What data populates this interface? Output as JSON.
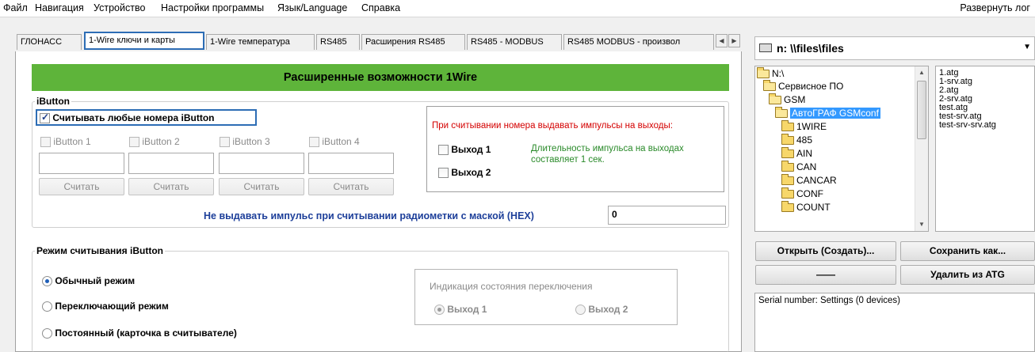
{
  "menubar": {
    "items": [
      "Файл",
      "Навигация",
      "Устройство",
      "Настройки программы",
      "Язык/Language",
      "Справка"
    ],
    "expand_label": "Развернуть лог"
  },
  "tabs": {
    "items": [
      "ГЛОНАСС",
      "1-Wire ключи и карты",
      "1-Wire температура",
      "RS485",
      "Расширения RS485",
      "RS485 - MODBUS",
      "RS485 MODBUS - произвол"
    ],
    "active_index": 1
  },
  "banner": {
    "title": "Расширенные возможности 1Wire"
  },
  "ibutton": {
    "group_title": "iButton",
    "read_any_label": "Считывать любые номера iButton",
    "read_any_checked": true,
    "slots": [
      {
        "label": "iButton 1",
        "value": "",
        "button": "Считать"
      },
      {
        "label": "iButton 2",
        "value": "",
        "button": "Считать"
      },
      {
        "label": "iButton 3",
        "value": "",
        "button": "Считать"
      },
      {
        "label": "iButton 4",
        "value": "",
        "button": "Считать"
      }
    ],
    "pulse_title": "При считывании номера выдавать импульсы на выходы:",
    "output1_label": "Выход 1",
    "output2_label": "Выход 2",
    "pulse_note": "Длительность импульса на выходах составляет 1 сек.",
    "mask_label": "Не выдавать импульс при считывании радиометки с маской (HEX)",
    "mask_value": "0"
  },
  "read_mode": {
    "group_title": "Режим считывания iButton",
    "options": [
      "Обычный режим",
      "Переключающий режим",
      "Постоянный (карточка в считывателе)"
    ],
    "selected_index": 0,
    "indication_title": "Индикация состояния переключения",
    "indication_options": [
      "Выход 1",
      "Выход 2"
    ],
    "indication_selected": 0
  },
  "file_browser": {
    "drive_label": "n: \\\\files\\files",
    "tree": [
      {
        "name": "N:\\",
        "level": 0,
        "open": true
      },
      {
        "name": "Сервисное ПО",
        "level": 1,
        "open": true
      },
      {
        "name": "GSM",
        "level": 2,
        "open": true
      },
      {
        "name": "АвтоГРАФ GSMconf",
        "level": 3,
        "open": true,
        "selected": true
      },
      {
        "name": "1WIRE",
        "level": 4
      },
      {
        "name": "485",
        "level": 4
      },
      {
        "name": "AIN",
        "level": 4
      },
      {
        "name": "CAN",
        "level": 4
      },
      {
        "name": "CANCAR",
        "level": 4
      },
      {
        "name": "CONF",
        "level": 4
      },
      {
        "name": "COUNT",
        "level": 4
      }
    ],
    "files": [
      "1.atg",
      "1-srv.atg",
      "2.atg",
      "2-srv.atg",
      "test.atg",
      "test-srv.atg",
      "test-srv-srv.atg"
    ],
    "open_button": "Открыть (Создать)...",
    "save_as_button": "Сохранить как...",
    "dash_button": "——",
    "delete_button": "Удалить из ATG",
    "serial_text": "Serial number: Settings (0 devices)"
  },
  "colors": {
    "banner_green": "#5eb43a",
    "highlight_blue": "#2d6db5",
    "pulse_red": "#d40000",
    "note_green": "#2a8a2a",
    "mask_blue": "#1d3f9a",
    "selection_blue": "#3399ff"
  }
}
